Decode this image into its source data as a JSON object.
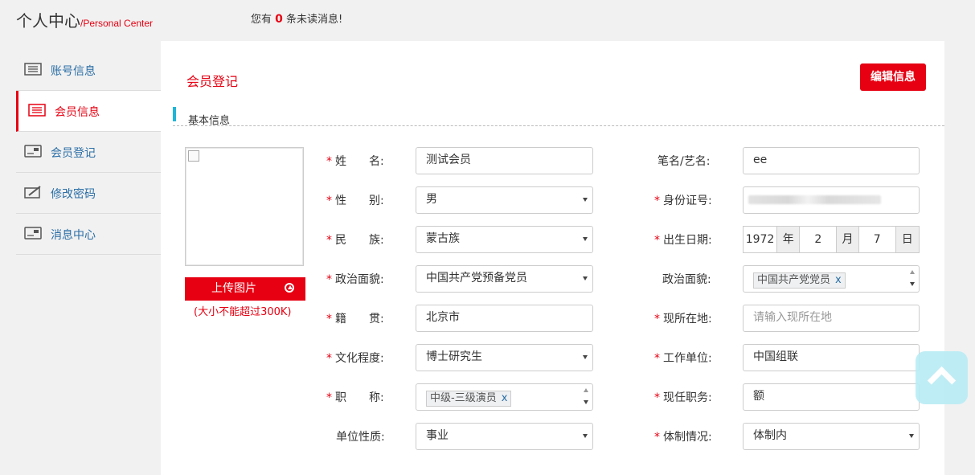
{
  "header": {
    "title": "个人中心",
    "subtitle": "/Personal Center",
    "msg_prefix": "您有 ",
    "msg_count": "0",
    "msg_suffix": " 条未读消息!"
  },
  "sidebar": {
    "items": [
      {
        "label": "账号信息",
        "icon": "id-card-icon",
        "active": false
      },
      {
        "label": "会员信息",
        "icon": "list-icon",
        "active": true
      },
      {
        "label": "会员登记",
        "icon": "card-icon",
        "active": false
      },
      {
        "label": "修改密码",
        "icon": "pencil-icon",
        "active": false
      },
      {
        "label": "消息中心",
        "icon": "card-icon",
        "active": false
      }
    ]
  },
  "main": {
    "title": "会员登记",
    "edit_button": "编辑信息",
    "section": "基本信息",
    "upload_button": "上传图片",
    "upload_note": "(大小不能超过300K)"
  },
  "form": {
    "left": [
      {
        "label": "姓　　名:",
        "required": true,
        "value": "测试会员",
        "type": "text"
      },
      {
        "label": "性　　别:",
        "required": true,
        "value": "男",
        "type": "select"
      },
      {
        "label": "民　　族:",
        "required": true,
        "value": "蒙古族",
        "type": "select"
      },
      {
        "label": "政治面貌:",
        "required": true,
        "value": "中国共产党预备党员",
        "type": "select"
      },
      {
        "label": "籍　　贯:",
        "required": true,
        "value": "北京市",
        "type": "text"
      },
      {
        "label": "文化程度:",
        "required": true,
        "value": "博士研究生",
        "type": "select"
      },
      {
        "label": "职　　称:",
        "required": true,
        "value": "中级-三级演员",
        "type": "tag"
      },
      {
        "label": "单位性质:",
        "required": false,
        "value": "事业",
        "type": "select"
      }
    ],
    "right": [
      {
        "label": "笔名/艺名:",
        "required": false,
        "value": "ee",
        "type": "text"
      },
      {
        "label": "身份证号:",
        "required": true,
        "value": "",
        "type": "blurred"
      },
      {
        "label": "出生日期:",
        "required": true,
        "type": "date"
      },
      {
        "label": "政治面貌:",
        "required": false,
        "value": "中国共产党党员",
        "type": "tag"
      },
      {
        "label": "现所在地:",
        "required": true,
        "value": "",
        "placeholder": "请输入现所在地",
        "type": "text"
      },
      {
        "label": "工作单位:",
        "required": true,
        "value": "中国组联",
        "type": "text"
      },
      {
        "label": "现任职务:",
        "required": true,
        "value": "额",
        "type": "text"
      },
      {
        "label": "体制情况:",
        "required": true,
        "value": "体制内",
        "type": "select"
      }
    ],
    "birth": {
      "year": "1972",
      "year_unit": "年",
      "month": "2",
      "month_unit": "月",
      "day": "7",
      "day_unit": "日"
    }
  },
  "colors": {
    "accent": "#e60012",
    "link": "#2a6ea6",
    "section_bar": "#1fb6d8",
    "back_to_top": "#b9ecf5"
  }
}
